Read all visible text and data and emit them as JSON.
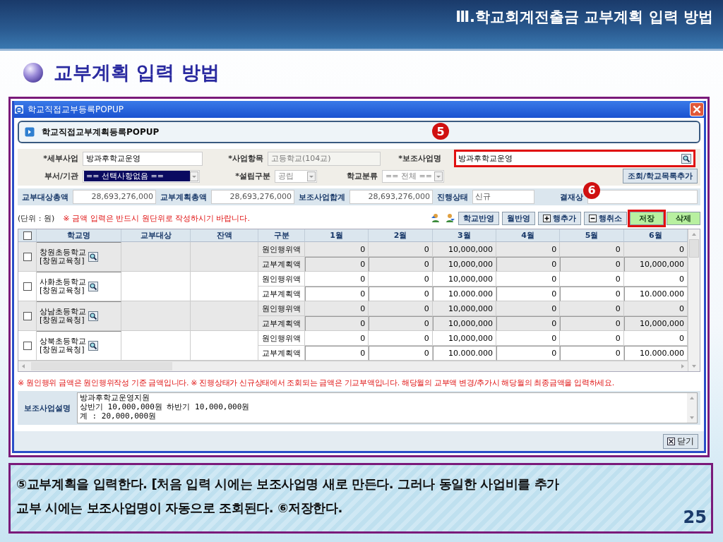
{
  "slide": {
    "section_title": "Ⅲ.학교회계전출금 교부계획 입력 방법",
    "heading": "교부계획 입력 방법",
    "page_number": "25",
    "caption_lines": [
      "⑤교부계획을 입력한다. [처음 입력 시에는 보조사업명 새로 만든다. 그러나 동일한 사업비를 추가",
      "교부 시에는 보조사업명이 자동으로 조회된다. ⑥저장한다."
    ]
  },
  "window": {
    "title": "학교직접교부등록POPUP",
    "panel_title": "학교직접교부계획등록POPUP"
  },
  "callouts": [
    {
      "number": "5"
    },
    {
      "number": "6"
    }
  ],
  "form": {
    "row_1": [
      {
        "label": "*세부사업",
        "value": "방과후학교운영",
        "disabled": false
      },
      {
        "label": "*사업항목",
        "value": "고등학교(104교)",
        "disabled": true
      },
      {
        "label": "*보조사업명",
        "value": "방과후학교운영",
        "highlighted": true
      }
    ],
    "row_2": [
      {
        "label": "부서/기관",
        "value": "== 선택사항없음 ==",
        "focused": true,
        "disabled": false
      },
      {
        "label": "*설립구분",
        "value": "공립",
        "focused": false,
        "disabled": true
      },
      {
        "label": "학교분류",
        "value": "== 전체 ==",
        "focused": false,
        "disabled": true
      }
    ],
    "search_button": "조회/학교목록추가"
  },
  "totals": [
    {
      "label": "교부대상총액",
      "value": "28,693,276,000"
    },
    {
      "label": "교부계획총액",
      "value": "28,693,276,000"
    },
    {
      "label": "보조사업합계",
      "value": "28,693,276,000"
    },
    {
      "label": "진행상태",
      "value": "신규"
    },
    {
      "label": "결재상"
    }
  ],
  "toolbar": {
    "unit": "(단위 : 원)",
    "notice": "※ 금액 입력은 반드시 원단위로 작성하시기 바랍니다.",
    "buttons": [
      {
        "label": "학교반영",
        "kind": "plain",
        "highlighted": false
      },
      {
        "label": "월반영",
        "kind": "plain",
        "highlighted": false
      },
      {
        "label": "행추가",
        "kind": "add",
        "highlighted": false
      },
      {
        "label": "행취소",
        "kind": "remove",
        "highlighted": false
      },
      {
        "label": "저장",
        "kind": "green",
        "highlighted": true
      },
      {
        "label": "삭제",
        "kind": "green",
        "highlighted": false
      }
    ]
  },
  "table": {
    "columns": [
      "학교명",
      "교부대상",
      "잔액",
      "구분",
      "1월",
      "2월",
      "3월",
      "4월",
      "5월",
      "6월"
    ],
    "all_checked": false,
    "schools": [
      {
        "name": "창원초등학교",
        "office": "[창원교육청]",
        "checked": false,
        "rows": [
          {
            "kind": "cause",
            "label": "원인행위액",
            "values": [
              "0",
              "0",
              "10,000,000",
              "0",
              "0",
              "0"
            ]
          },
          {
            "kind": "plan",
            "label": "교부계획액",
            "values": [
              "0",
              "0",
              "10,000,000",
              "0",
              "0",
              "10,000,000"
            ]
          }
        ]
      },
      {
        "name": "사화초등학교",
        "office": "[창원교육청]",
        "checked": false,
        "rows": [
          {
            "kind": "cause",
            "label": "원인행위액",
            "values": [
              "0",
              "0",
              "10,000,000",
              "0",
              "0",
              "0"
            ]
          },
          {
            "kind": "plan",
            "label": "교부계획액",
            "values": [
              "0",
              "0",
              "10.000.000",
              "0",
              "0",
              "10.000.000"
            ]
          }
        ]
      },
      {
        "name": "상남초등학교",
        "office": "[창원교육청]",
        "checked": false,
        "rows": [
          {
            "kind": "cause",
            "label": "원인행위액",
            "values": [
              "0",
              "0",
              "10,000,000",
              "0",
              "0",
              "0"
            ]
          },
          {
            "kind": "plan",
            "label": "교부계획액",
            "values": [
              "0",
              "0",
              "10,000,000",
              "0",
              "0",
              "10,000,000"
            ]
          }
        ]
      },
      {
        "name": "상북초등학교",
        "office": "[창원교육청]",
        "checked": false,
        "rows": [
          {
            "kind": "cause",
            "label": "원인행위액",
            "values": [
              "0",
              "0",
              "10,000,000",
              "0",
              "0",
              "0"
            ]
          },
          {
            "kind": "plan",
            "label": "교부계획액",
            "values": [
              "0",
              "0",
              "10.000.000",
              "0",
              "0",
              "10.000.000"
            ]
          }
        ]
      }
    ]
  },
  "bottom_notice": "※ 원인행위 금액은 원인행위작성 기준 금액입니다.  ※ 진행상태가 신규상태에서 조회되는 금액은 기교부액입니다. 해당월의 교부액 변경/추가시 해당월의 최종금액을 입력하세요.",
  "description": {
    "label": "보조사업설명",
    "lines": [
      "방과후학교운영지원",
      "상반기 10,000,000원 하반기 10,000,000원",
      "계 : 20,000,000원"
    ]
  },
  "close_button": "닫기"
}
